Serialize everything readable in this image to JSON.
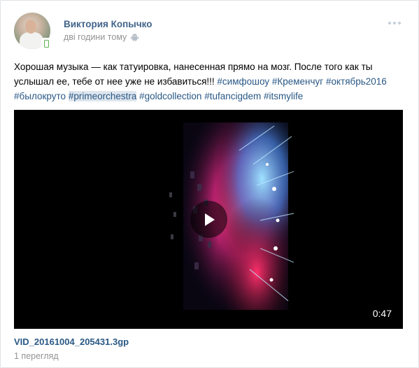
{
  "post": {
    "author": "Виктория Копычко",
    "time": "дві години тому",
    "text_prefix": "Хорошая музыка — как татуировка, нанесенная прямо на мозг. После того как ты услышал ее, тебе от нее уже не избавиться!!! ",
    "hashtags": [
      {
        "text": "#симфошоу",
        "highlighted": false
      },
      {
        "text": "#Кременчуг",
        "highlighted": false
      },
      {
        "text": "#октябрь2016",
        "highlighted": false
      },
      {
        "text": "#былокруто",
        "highlighted": false
      },
      {
        "text": "#primeorchestra",
        "highlighted": true
      },
      {
        "text": "#goldcollection",
        "highlighted": false
      },
      {
        "text": "#tufancigdem",
        "highlighted": false
      },
      {
        "text": "#itsmylife",
        "highlighted": false
      }
    ]
  },
  "video": {
    "duration": "0:47",
    "title": "VID_20161004_205431.3gp",
    "views": "1 перегляд"
  },
  "icons": {
    "more": "more-dots-icon",
    "platform": "android-icon",
    "mobile": "mobile-badge-icon",
    "play": "play-icon"
  },
  "colors": {
    "link": "#2a5885",
    "author": "#42648b",
    "meta": "#939393",
    "hashtag_highlight": "#dfe6ee"
  }
}
